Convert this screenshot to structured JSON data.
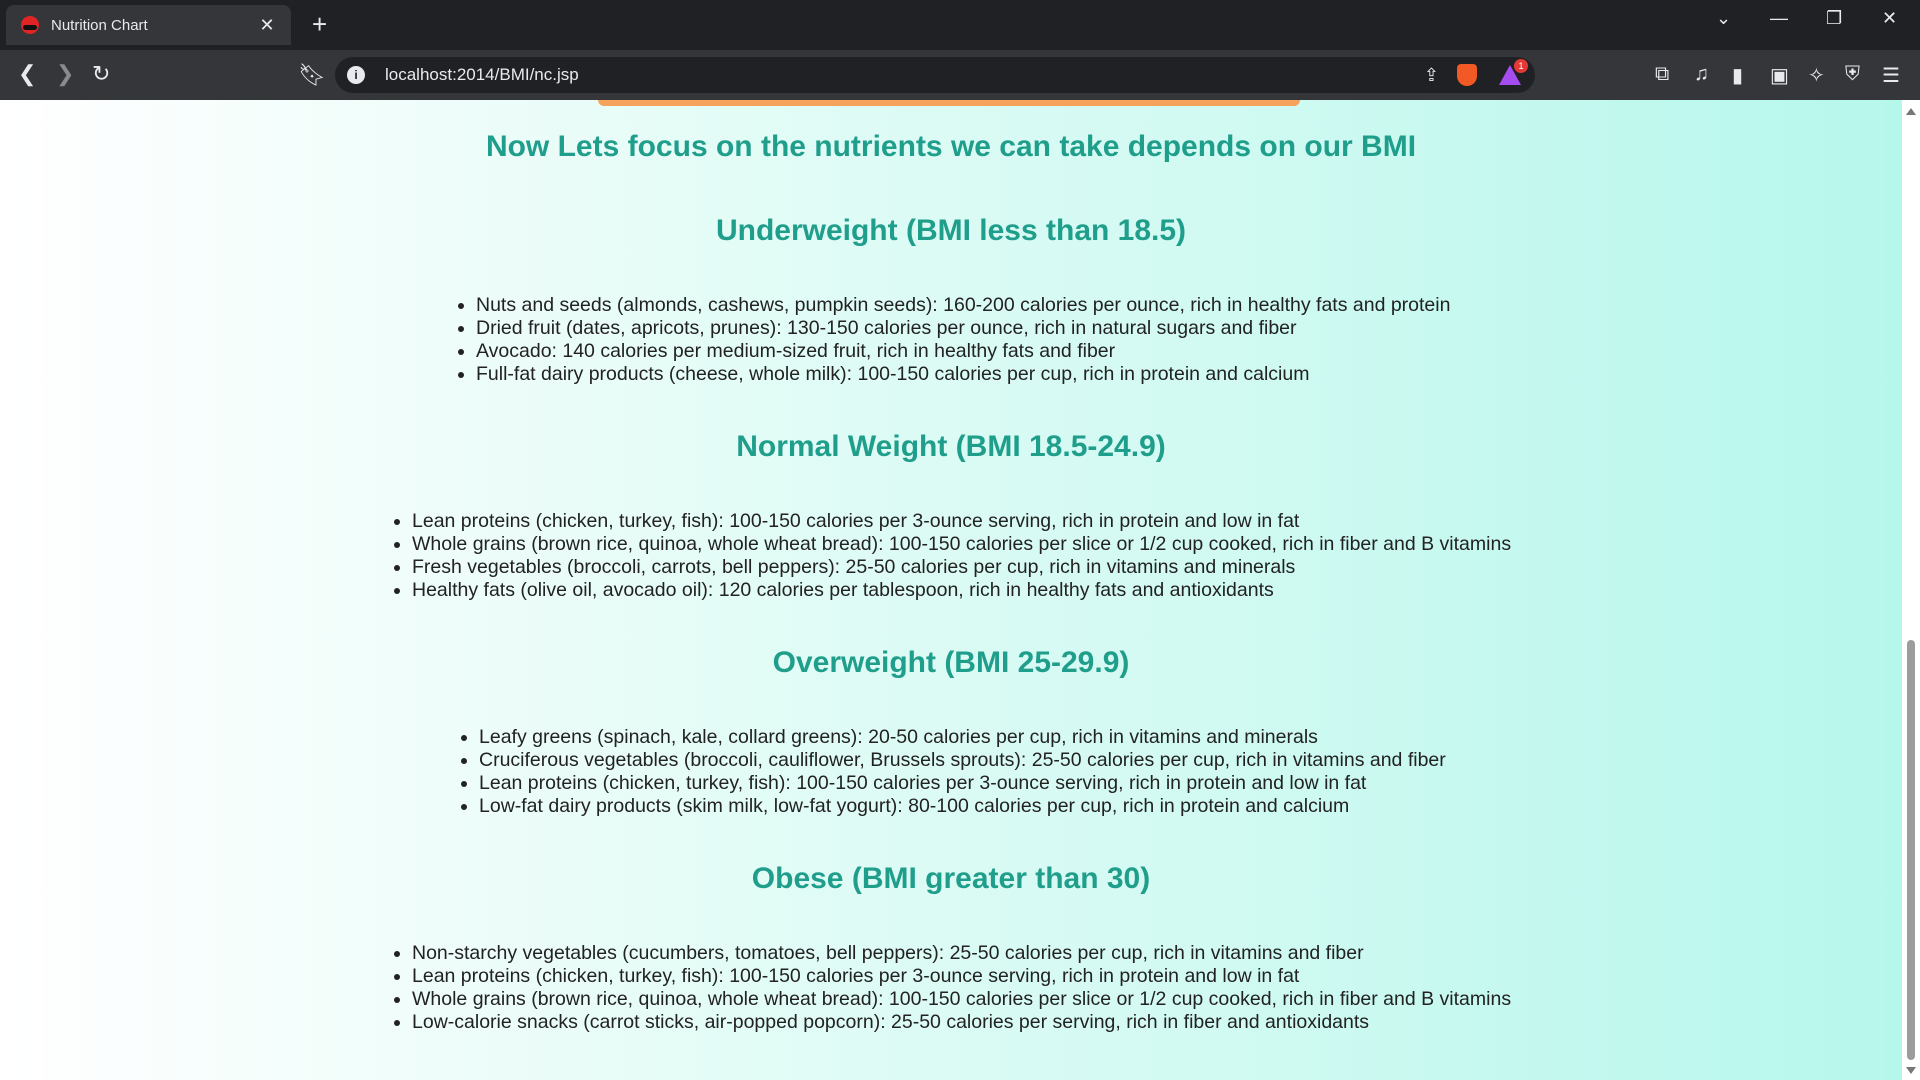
{
  "browser": {
    "tab_title": "Nutrition Chart",
    "tab_close": "✕",
    "new_tab": "+",
    "url": "localhost:2014/BMI/nc.jsp",
    "rewards_badge": "1"
  },
  "page": {
    "heading": "Now Lets focus on the nutrients we can take depends on our BMI",
    "sections": [
      {
        "title": "Underweight (BMI less than 18.5)",
        "items": [
          "Nuts and seeds (almonds, cashews, pumpkin seeds): 160-200 calories per ounce, rich in healthy fats and protein",
          "Dried fruit (dates, apricots, prunes): 130-150 calories per ounce, rich in natural sugars and fiber",
          "Avocado: 140 calories per medium-sized fruit, rich in healthy fats and fiber",
          "Full-fat dairy products (cheese, whole milk): 100-150 calories per cup, rich in protein and calcium"
        ]
      },
      {
        "title": "Normal Weight (BMI 18.5-24.9)",
        "items": [
          "Lean proteins (chicken, turkey, fish): 100-150 calories per 3-ounce serving, rich in protein and low in fat",
          "Whole grains (brown rice, quinoa, whole wheat bread): 100-150 calories per slice or 1/2 cup cooked, rich in fiber and B vitamins",
          "Fresh vegetables (broccoli, carrots, bell peppers): 25-50 calories per cup, rich in vitamins and minerals",
          "Healthy fats (olive oil, avocado oil): 120 calories per tablespoon, rich in healthy fats and antioxidants"
        ]
      },
      {
        "title": "Overweight (BMI 25-29.9)",
        "items": [
          "Leafy greens (spinach, kale, collard greens): 20-50 calories per cup, rich in vitamins and minerals",
          "Cruciferous vegetables (broccoli, cauliflower, Brussels sprouts): 25-50 calories per cup, rich in vitamins and fiber",
          "Lean proteins (chicken, turkey, fish): 100-150 calories per 3-ounce serving, rich in protein and low in fat",
          "Low-fat dairy products (skim milk, low-fat yogurt): 80-100 calories per cup, rich in protein and calcium"
        ]
      },
      {
        "title": "Obese (BMI greater than 30)",
        "items": [
          "Non-starchy vegetables (cucumbers, tomatoes, bell peppers): 25-50 calories per cup, rich in vitamins and fiber",
          "Lean proteins (chicken, turkey, fish): 100-150 calories per 3-ounce serving, rich in protein and low in fat",
          "Whole grains (brown rice, quinoa, whole wheat bread): 100-150 calories per slice or 1/2 cup cooked, rich in fiber and B vitamins",
          "Low-calorie snacks (carrot sticks, air-popped popcorn): 25-50 calories per serving, rich in fiber and antioxidants"
        ]
      }
    ]
  },
  "colors": {
    "heading": "#1f9e8b",
    "accent_bar": "#f5a25d"
  }
}
